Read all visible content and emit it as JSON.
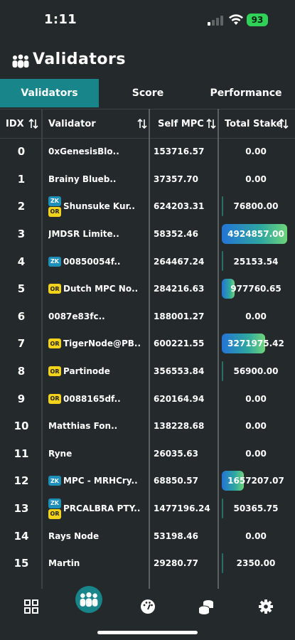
{
  "status_bar": {
    "time": "1:11",
    "battery": "93"
  },
  "header": {
    "title": "Validators",
    "icon": "users-icon"
  },
  "tabs": [
    {
      "label": "Validators",
      "active": true
    },
    {
      "label": "Score",
      "active": false
    },
    {
      "label": "Performance",
      "active": false
    }
  ],
  "table": {
    "columns": {
      "idx": "IDX",
      "validator": "Validator",
      "self_mpc": "Self MPC",
      "total_stake": "Total Stake"
    },
    "rows": [
      {
        "idx": "0",
        "name": "0xGenesisBlo..",
        "badges": [],
        "self_mpc": "153716.57",
        "total_stake": "0.00"
      },
      {
        "idx": "1",
        "name": "Brainy Blueb..",
        "badges": [],
        "self_mpc": "37357.70",
        "total_stake": "0.00"
      },
      {
        "idx": "2",
        "name": "Shunsuke Kur..",
        "badges": [
          "ZK",
          "OR"
        ],
        "self_mpc": "624203.31",
        "total_stake": "76800.00"
      },
      {
        "idx": "3",
        "name": "JMDSR Limite..",
        "badges": [],
        "self_mpc": "58352.46",
        "total_stake": "4924857.00"
      },
      {
        "idx": "4",
        "name": "00850054f..",
        "badges": [
          "ZK"
        ],
        "self_mpc": "264467.24",
        "total_stake": "25153.54"
      },
      {
        "idx": "5",
        "name": "Dutch MPC No..",
        "badges": [
          "OR"
        ],
        "self_mpc": "284216.63",
        "total_stake": "977760.65"
      },
      {
        "idx": "6",
        "name": "0087e83fc..",
        "badges": [],
        "self_mpc": "188001.27",
        "total_stake": "0.00"
      },
      {
        "idx": "7",
        "name": "TigerNode@PB..",
        "badges": [
          "OR"
        ],
        "self_mpc": "600221.55",
        "total_stake": "3271975.42"
      },
      {
        "idx": "8",
        "name": "Partinode",
        "badges": [
          "OR"
        ],
        "self_mpc": "356553.84",
        "total_stake": "56900.00"
      },
      {
        "idx": "9",
        "name": "0088165df..",
        "badges": [
          "OR"
        ],
        "self_mpc": "620164.94",
        "total_stake": "0.00"
      },
      {
        "idx": "10",
        "name": "Matthias Fon..",
        "badges": [],
        "self_mpc": "138228.68",
        "total_stake": "0.00"
      },
      {
        "idx": "11",
        "name": "Ryne",
        "badges": [],
        "self_mpc": "26035.63",
        "total_stake": "0.00"
      },
      {
        "idx": "12",
        "name": "MPC - MRHCry..",
        "badges": [
          "ZK"
        ],
        "self_mpc": "68850.57",
        "total_stake": "1657207.07"
      },
      {
        "idx": "13",
        "name": "PRCALBRA PTY..",
        "badges": [
          "ZK",
          "OR"
        ],
        "self_mpc": "1477196.24",
        "total_stake": "50365.75"
      },
      {
        "idx": "14",
        "name": "Rays Node",
        "badges": [],
        "self_mpc": "53198.46",
        "total_stake": "0.00"
      },
      {
        "idx": "15",
        "name": "Martin",
        "badges": [],
        "self_mpc": "29280.77",
        "total_stake": "2350.00"
      }
    ]
  },
  "bottom_nav": [
    {
      "icon": "dashboard-icon",
      "active": false
    },
    {
      "icon": "validators-icon",
      "active": true
    },
    {
      "icon": "performance-icon",
      "active": false
    },
    {
      "icon": "coins-icon",
      "active": false
    },
    {
      "icon": "settings-icon",
      "active": false
    }
  ],
  "colors": {
    "background": "#242a2c",
    "accent": "#17858a",
    "zk_badge": "#1d8fb8",
    "or_badge": "#f2d21b"
  }
}
